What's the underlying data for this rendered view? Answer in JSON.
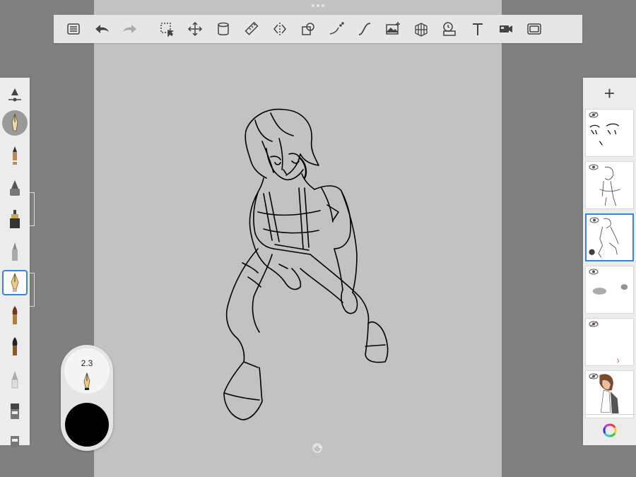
{
  "toolbar": {
    "tools": [
      "menu",
      "undo",
      "redo",
      "selection",
      "transform",
      "fill",
      "ruler",
      "symmetry",
      "shapes",
      "stroke-style",
      "curve",
      "import-image",
      "perspective",
      "time-lapse",
      "text",
      "record",
      "fullscreen"
    ]
  },
  "brush_palette": {
    "selected_brush": "pen",
    "brushes": [
      "size-opacity-slider",
      "ink-pen",
      "pencil",
      "airbrush",
      "marker",
      "paint-brush",
      "pen",
      "brush",
      "ink",
      "chisel",
      "eraser",
      "smudge"
    ]
  },
  "puck": {
    "brush_size": "2.3",
    "current_color": "#000000"
  },
  "layers": {
    "add_label": "+",
    "count": 6,
    "selected_index": 2
  },
  "colors": {
    "accent": "#3b82d9",
    "canvas": "#c2c2c2",
    "workspace": "#808080"
  }
}
